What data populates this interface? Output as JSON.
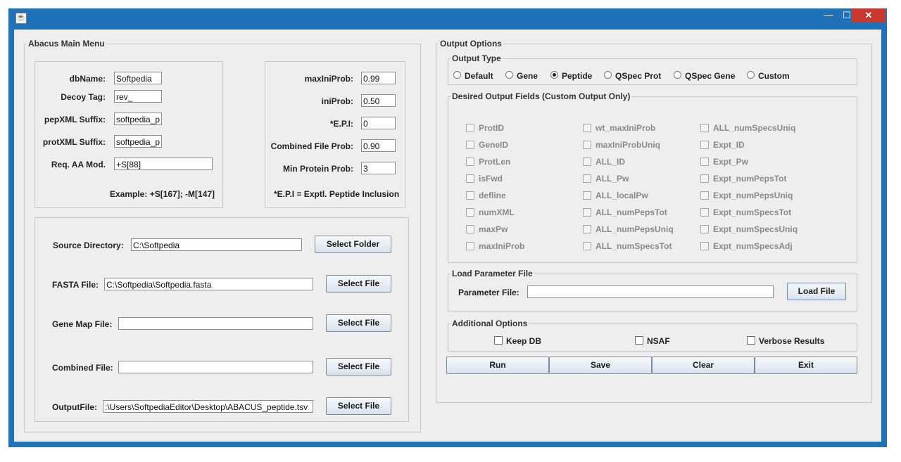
{
  "window": {
    "close_glyph": "✕",
    "minimize_glyph": "—",
    "maximize_glyph": "☐",
    "app_icon_glyph": "☕"
  },
  "main_menu": {
    "title": "Abacus Main Menu",
    "db_name_label": "dbName:",
    "db_name_value": "Softpedia",
    "decoy_tag_label": "Decoy Tag:",
    "decoy_tag_value": "rev_",
    "pepxml_label": "pepXML Suffix:",
    "pepxml_value": "softpedia_p",
    "protxml_label": "protXML Suffix:",
    "protxml_value": "softpedia_p",
    "req_aa_label": "Req. AA Mod.",
    "req_aa_value": "+S[88]",
    "example_text": "Example: +S[167]; -M[147]"
  },
  "probs": {
    "maxiniprob_label": "maxIniProb:",
    "maxiniprob_value": "0.99",
    "iniprob_label": "iniProb:",
    "iniprob_value": "0.50",
    "epi_label": "*E.P.I:",
    "epi_value": "0",
    "combined_prob_label": "Combined File Prob:",
    "combined_prob_value": "0.90",
    "min_protein_label": "Min Protein Prob:",
    "min_protein_value": "3",
    "epi_note": "*E.P.I = Exptl. Peptide Inclusion"
  },
  "files": {
    "source_dir_label": "Source Directory:",
    "source_dir_value": "C:\\Softpedia",
    "select_folder": "Select Folder",
    "fasta_label": "FASTA File:",
    "fasta_value": "C:\\Softpedia\\Softpedia.fasta",
    "gene_map_label": "Gene Map File:",
    "gene_map_value": "",
    "combined_label": "Combined File:",
    "combined_value": "",
    "output_label": "OutputFile:",
    "output_value": ":\\Users\\SoftpediaEditor\\Desktop\\ABACUS_peptide.tsv",
    "select_file": "Select File"
  },
  "output_options": {
    "title": "Output Options",
    "output_type_title": "Output Type",
    "types": [
      {
        "label": "Default",
        "selected": false
      },
      {
        "label": "Gene",
        "selected": false
      },
      {
        "label": "Peptide",
        "selected": true
      },
      {
        "label": "QSpec Prot",
        "selected": false
      },
      {
        "label": "QSpec Gene",
        "selected": false
      },
      {
        "label": "Custom",
        "selected": false
      }
    ],
    "fields_title": "Desired Output Fields (Custom Output Only)",
    "fields_col1": [
      "ProtID",
      "GeneID",
      "ProtLen",
      "isFwd",
      "defline",
      "numXML",
      "maxPw",
      "maxIniProb"
    ],
    "fields_col2": [
      "wt_maxIniProb",
      "maxIniProbUniq",
      "ALL_ID",
      "ALL_Pw",
      "ALL_localPw",
      "ALL_numPepsTot",
      "ALL_numPepsUniq",
      "ALL_numSpecsTot"
    ],
    "fields_col3": [
      "ALL_numSpecsUniq",
      "Expt_ID",
      "Expt_Pw",
      "Expt_numPepsTot",
      "Expt_numPepsUniq",
      "Expt_numSpecsTot",
      "Expt_numSpecsUniq",
      "Expt_numSpecsAdj"
    ],
    "load_param_title": "Load Parameter File",
    "param_file_label": "Parameter File:",
    "param_file_value": "",
    "load_file": "Load File",
    "additional_title": "Additional Options",
    "keep_db": "Keep DB",
    "nsaf": "NSAF",
    "verbose": "Verbose Results"
  },
  "actions": {
    "run": "Run",
    "save": "Save",
    "clear": "Clear",
    "exit": "Exit"
  }
}
